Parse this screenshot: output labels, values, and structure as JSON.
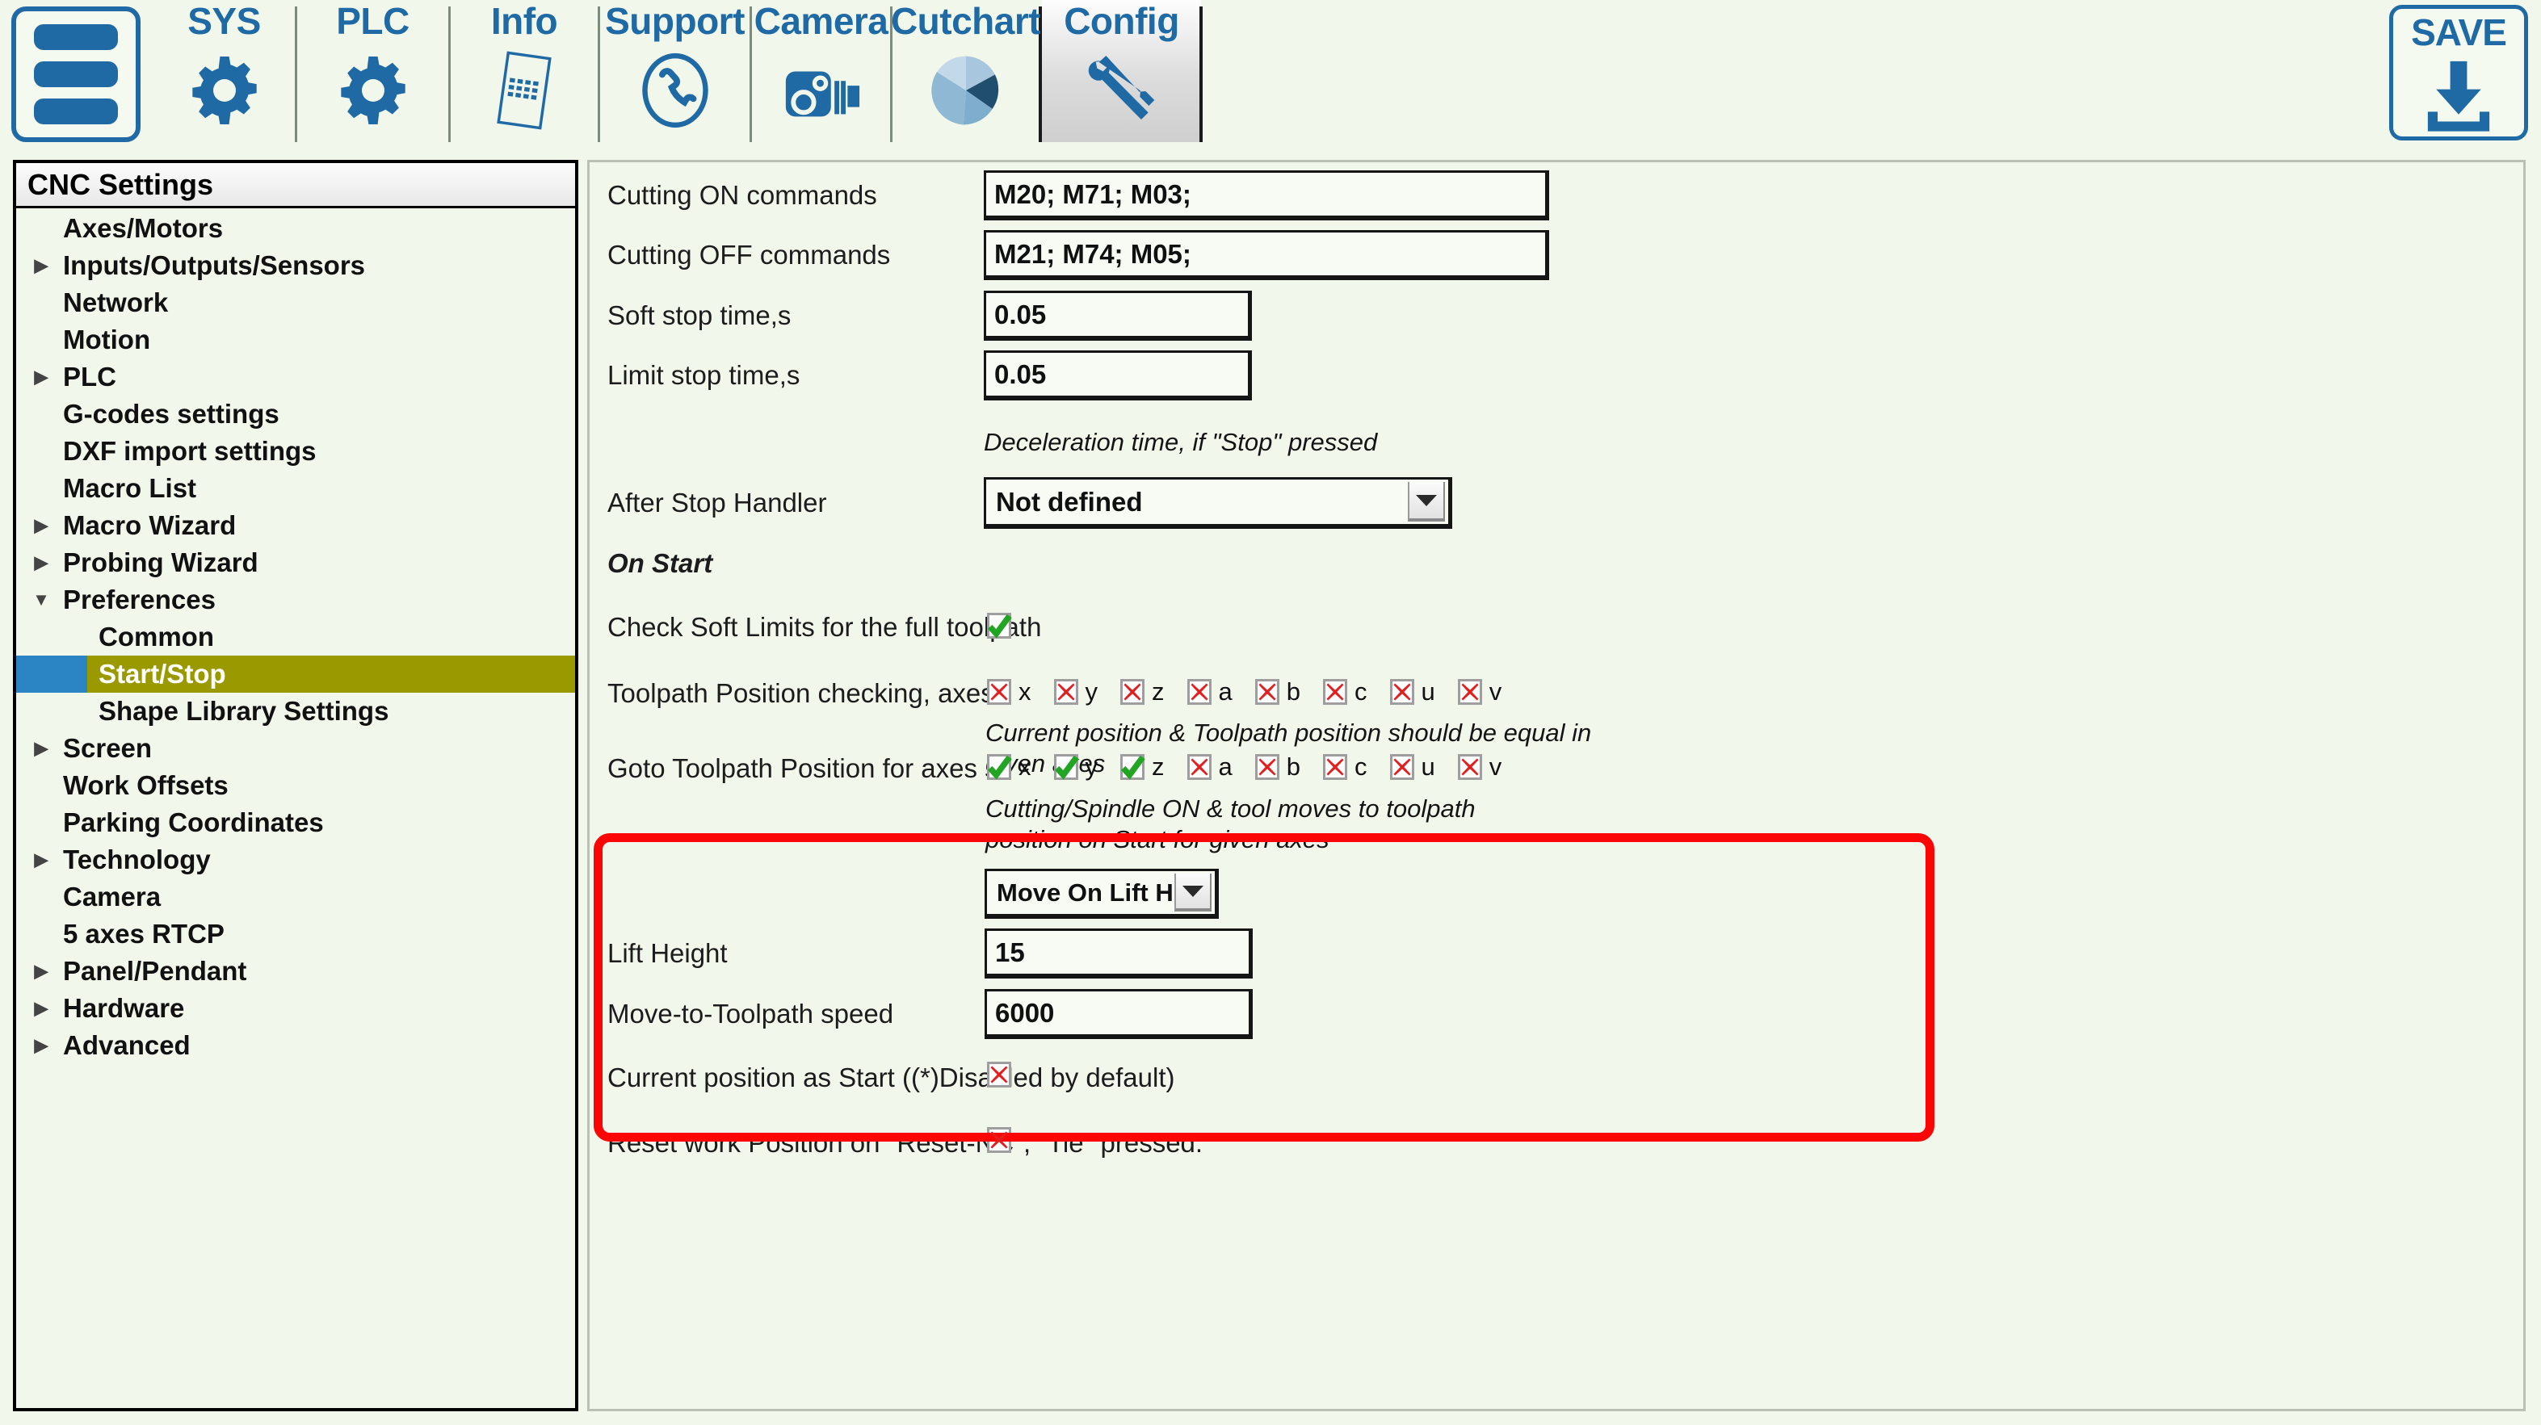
{
  "toolbar": {
    "menu_button": "menu-hamburger",
    "tabs": [
      {
        "label": "SYS",
        "icon": "gear-icon"
      },
      {
        "label": "PLC",
        "icon": "gear-icon"
      },
      {
        "label": "Info",
        "icon": "document-icon"
      },
      {
        "label": "Support",
        "icon": "phone-icon"
      },
      {
        "label": "Camera",
        "icon": "camera-icon"
      },
      {
        "label": "Cutchart",
        "icon": "pie-chart-icon"
      },
      {
        "label": "Config",
        "icon": "tools-icon",
        "active": true
      }
    ],
    "save_label": "SAVE",
    "save_icon": "download-arrow-icon"
  },
  "sidebar": {
    "title": "CNC Settings",
    "items": [
      {
        "label": "Axes/Motors",
        "indent": 1,
        "arrow": ""
      },
      {
        "label": "Inputs/Outputs/Sensors",
        "indent": 1,
        "arrow": "collapsed"
      },
      {
        "label": "Network",
        "indent": 1,
        "arrow": ""
      },
      {
        "label": "Motion",
        "indent": 1,
        "arrow": ""
      },
      {
        "label": "PLC",
        "indent": 1,
        "arrow": "collapsed"
      },
      {
        "label": "G-codes settings",
        "indent": 1,
        "arrow": ""
      },
      {
        "label": "DXF import settings",
        "indent": 1,
        "arrow": ""
      },
      {
        "label": "Macro List",
        "indent": 1,
        "arrow": ""
      },
      {
        "label": "Macro Wizard",
        "indent": 1,
        "arrow": "collapsed"
      },
      {
        "label": "Probing Wizard",
        "indent": 1,
        "arrow": "collapsed"
      },
      {
        "label": "Preferences",
        "indent": 1,
        "arrow": "expanded"
      },
      {
        "label": "Common",
        "indent": 2,
        "arrow": ""
      },
      {
        "label": "Start/Stop",
        "indent": 2,
        "arrow": "",
        "selected": true
      },
      {
        "label": "Shape Library Settings",
        "indent": 2,
        "arrow": ""
      },
      {
        "label": "Screen",
        "indent": 1,
        "arrow": "collapsed"
      },
      {
        "label": "Work Offsets",
        "indent": 1,
        "arrow": ""
      },
      {
        "label": "Parking Coordinates",
        "indent": 1,
        "arrow": ""
      },
      {
        "label": "Technology",
        "indent": 1,
        "arrow": "collapsed"
      },
      {
        "label": "Camera",
        "indent": 1,
        "arrow": ""
      },
      {
        "label": "5 axes RTCP",
        "indent": 1,
        "arrow": ""
      },
      {
        "label": "Panel/Pendant",
        "indent": 1,
        "arrow": "collapsed"
      },
      {
        "label": "Hardware",
        "indent": 1,
        "arrow": "collapsed"
      },
      {
        "label": "Advanced",
        "indent": 1,
        "arrow": "collapsed"
      }
    ]
  },
  "form": {
    "cutting_on": {
      "label": "Cutting ON commands",
      "value": "M20; M71; M03;"
    },
    "cutting_off": {
      "label": "Cutting OFF commands",
      "value": "M21; M74; M05;"
    },
    "soft_stop": {
      "label": "Soft stop time,s",
      "value": "0.05"
    },
    "limit_stop": {
      "label": "Limit stop time,s",
      "value": "0.05"
    },
    "decel_hint": "Deceleration time, if \"Stop\" pressed",
    "after_stop": {
      "label": "After Stop Handler",
      "value": "Not defined"
    },
    "on_start_heading": "On Start",
    "check_soft_limits": {
      "label": "Check Soft Limits for the full toolpath",
      "checked": true
    },
    "toolpath_checking": {
      "label": "Toolpath Position checking, axes",
      "axes": [
        "x",
        "y",
        "z",
        "a",
        "b",
        "c",
        "u",
        "v"
      ],
      "values": [
        false,
        false,
        false,
        false,
        false,
        false,
        false,
        false
      ],
      "hint": "Current position & Toolpath position should be equal in given axes"
    },
    "goto_toolpath": {
      "label": "Goto Toolpath Position for axes",
      "axes": [
        "x",
        "y",
        "z",
        "a",
        "b",
        "c",
        "u",
        "v"
      ],
      "values": [
        true,
        true,
        true,
        false,
        false,
        false,
        false,
        false
      ],
      "hint": "Cutting/Spindle ON & tool moves to toolpath position on Start for given axes",
      "mode": "Move On Lift Heig"
    },
    "lift_height": {
      "label": "Lift Height",
      "value": "15"
    },
    "move_speed": {
      "label": "Move-to-Toolpath speed",
      "value": "6000"
    },
    "current_pos_start": {
      "label": "Current position as Start ((*)Disabled by default)",
      "checked": false
    },
    "reset_work_pos": {
      "label": "Reset work Position on \"Reset-NC\", \"Tie\" pressed.",
      "checked": false
    }
  },
  "colors": {
    "accent_blue": "#1f6aa5",
    "page_bg": "#f2f7ec",
    "selection_olive": "#9a9a00",
    "selection_marker_blue": "#2b84c4",
    "highlight_red": "#fb0505",
    "check_green": "#22a522",
    "cross_red": "#e02020"
  }
}
